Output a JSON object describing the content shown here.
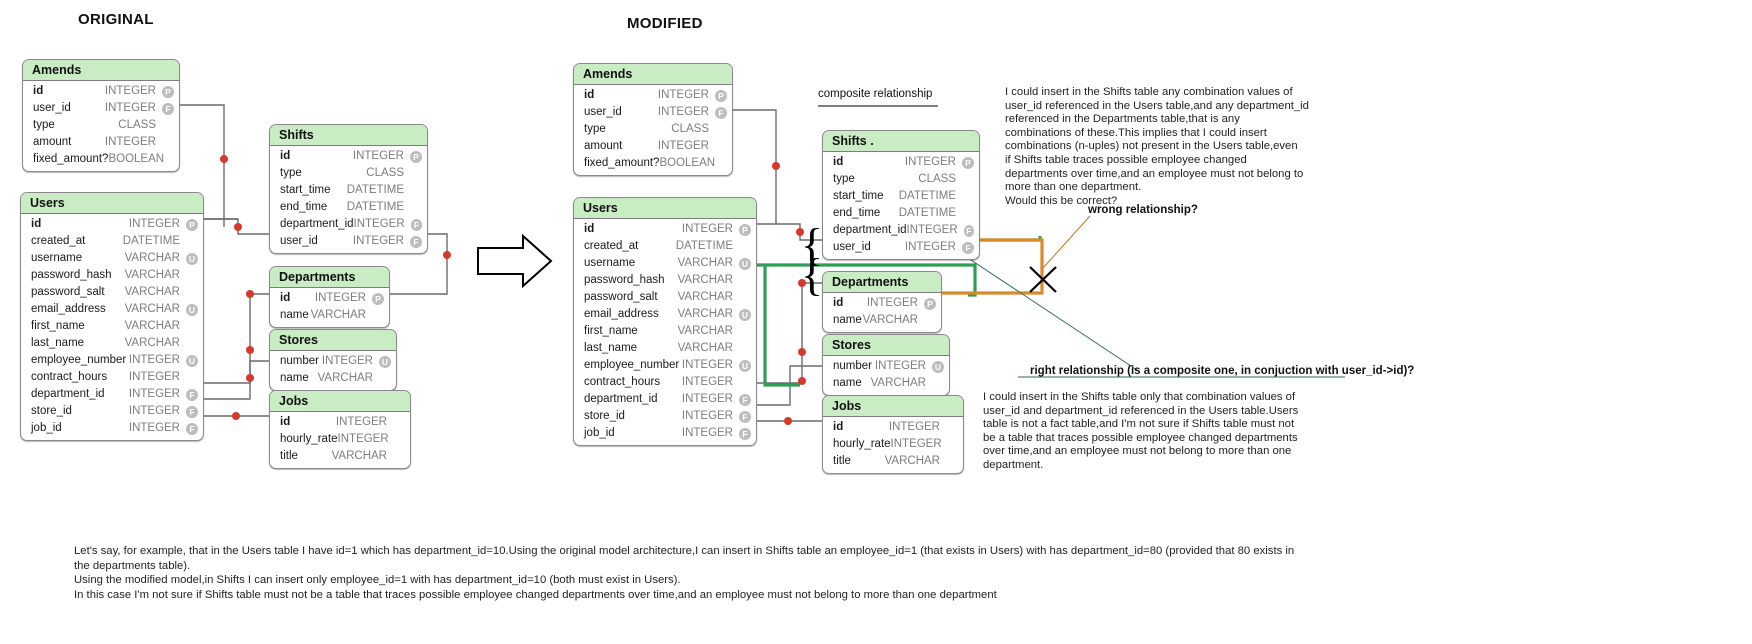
{
  "headings": {
    "original": "ORIGINAL",
    "modified": "MODIFIED"
  },
  "labels": {
    "composite_relationship": "composite relationship",
    "wrong_relationship": "wrong relationship?",
    "right_relationship": "right relationship (is a composite one, in conjuction with user_id->id)?"
  },
  "badges": {
    "primary": "P",
    "foreign": "F",
    "unique": "U"
  },
  "original": {
    "tables": [
      {
        "name": "Amends",
        "fields": [
          {
            "name": "id",
            "type": "INTEGER",
            "key": "P",
            "pk": true
          },
          {
            "name": "user_id",
            "type": "INTEGER",
            "key": "F",
            "pk": false
          },
          {
            "name": "type",
            "type": "CLASS",
            "key": "",
            "pk": false
          },
          {
            "name": "amount",
            "type": "INTEGER",
            "key": "",
            "pk": false
          },
          {
            "name": "fixed_amount?",
            "type": "BOOLEAN",
            "key": "",
            "pk": false
          }
        ]
      },
      {
        "name": "Users",
        "fields": [
          {
            "name": "id",
            "type": "INTEGER",
            "key": "P",
            "pk": true
          },
          {
            "name": "created_at",
            "type": "DATETIME",
            "key": "",
            "pk": false
          },
          {
            "name": "username",
            "type": "VARCHAR",
            "key": "U",
            "pk": false
          },
          {
            "name": "password_hash",
            "type": "VARCHAR",
            "key": "",
            "pk": false
          },
          {
            "name": "password_salt",
            "type": "VARCHAR",
            "key": "",
            "pk": false
          },
          {
            "name": "email_address",
            "type": "VARCHAR",
            "key": "U",
            "pk": false
          },
          {
            "name": "first_name",
            "type": "VARCHAR",
            "key": "",
            "pk": false
          },
          {
            "name": "last_name",
            "type": "VARCHAR",
            "key": "",
            "pk": false
          },
          {
            "name": "employee_number",
            "type": "INTEGER",
            "key": "U",
            "pk": false
          },
          {
            "name": "contract_hours",
            "type": "INTEGER",
            "key": "",
            "pk": false
          },
          {
            "name": "department_id",
            "type": "INTEGER",
            "key": "F",
            "pk": false
          },
          {
            "name": "store_id",
            "type": "INTEGER",
            "key": "F",
            "pk": false
          },
          {
            "name": "job_id",
            "type": "INTEGER",
            "key": "F",
            "pk": false
          }
        ]
      },
      {
        "name": "Shifts",
        "fields": [
          {
            "name": "id",
            "type": "INTEGER",
            "key": "P",
            "pk": true
          },
          {
            "name": "type",
            "type": "CLASS",
            "key": "",
            "pk": false
          },
          {
            "name": "start_time",
            "type": "DATETIME",
            "key": "",
            "pk": false
          },
          {
            "name": "end_time",
            "type": "DATETIME",
            "key": "",
            "pk": false
          },
          {
            "name": "department_id",
            "type": "INTEGER",
            "key": "F",
            "pk": false
          },
          {
            "name": "user_id",
            "type": "INTEGER",
            "key": "F",
            "pk": false
          }
        ]
      },
      {
        "name": "Departments",
        "fields": [
          {
            "name": "id",
            "type": "INTEGER",
            "key": "P",
            "pk": true
          },
          {
            "name": "name",
            "type": "VARCHAR",
            "key": "",
            "pk": false
          }
        ]
      },
      {
        "name": "Stores",
        "fields": [
          {
            "name": "number",
            "type": "INTEGER",
            "key": "U",
            "pk": false
          },
          {
            "name": "name",
            "type": "VARCHAR",
            "key": "",
            "pk": false
          }
        ]
      },
      {
        "name": "Jobs",
        "fields": [
          {
            "name": "id",
            "type": "INTEGER",
            "key": "P",
            "pk": true
          },
          {
            "name": "hourly_rate",
            "type": "INTEGER",
            "key": "",
            "pk": false
          },
          {
            "name": "title",
            "type": "VARCHAR",
            "key": "",
            "pk": false
          }
        ]
      }
    ]
  },
  "modified": {
    "tables": [
      {
        "name": "Amends",
        "fields": [
          {
            "name": "id",
            "type": "INTEGER",
            "key": "P",
            "pk": true
          },
          {
            "name": "user_id",
            "type": "INTEGER",
            "key": "F",
            "pk": false
          },
          {
            "name": "type",
            "type": "CLASS",
            "key": "",
            "pk": false
          },
          {
            "name": "amount",
            "type": "INTEGER",
            "key": "",
            "pk": false
          },
          {
            "name": "fixed_amount?",
            "type": "BOOLEAN",
            "key": "",
            "pk": false
          }
        ]
      },
      {
        "name": "Users",
        "fields": [
          {
            "name": "id",
            "type": "INTEGER",
            "key": "P",
            "pk": true
          },
          {
            "name": "created_at",
            "type": "DATETIME",
            "key": "",
            "pk": false
          },
          {
            "name": "username",
            "type": "VARCHAR",
            "key": "U",
            "pk": false
          },
          {
            "name": "password_hash",
            "type": "VARCHAR",
            "key": "",
            "pk": false
          },
          {
            "name": "password_salt",
            "type": "VARCHAR",
            "key": "",
            "pk": false
          },
          {
            "name": "email_address",
            "type": "VARCHAR",
            "key": "U",
            "pk": false
          },
          {
            "name": "first_name",
            "type": "VARCHAR",
            "key": "",
            "pk": false
          },
          {
            "name": "last_name",
            "type": "VARCHAR",
            "key": "",
            "pk": false
          },
          {
            "name": "employee_number",
            "type": "INTEGER",
            "key": "U",
            "pk": false
          },
          {
            "name": "contract_hours",
            "type": "INTEGER",
            "key": "",
            "pk": false
          },
          {
            "name": "department_id",
            "type": "INTEGER",
            "key": "F",
            "pk": false
          },
          {
            "name": "store_id",
            "type": "INTEGER",
            "key": "F",
            "pk": false
          },
          {
            "name": "job_id",
            "type": "INTEGER",
            "key": "F",
            "pk": false
          }
        ]
      },
      {
        "name": "Shifts .",
        "fields": [
          {
            "name": "id",
            "type": "INTEGER",
            "key": "P",
            "pk": true
          },
          {
            "name": "type",
            "type": "CLASS",
            "key": "",
            "pk": false
          },
          {
            "name": "start_time",
            "type": "DATETIME",
            "key": "",
            "pk": false
          },
          {
            "name": "end_time",
            "type": "DATETIME",
            "key": "",
            "pk": false
          },
          {
            "name": "department_id",
            "type": "INTEGER",
            "key": "F",
            "pk": false
          },
          {
            "name": "user_id",
            "type": "INTEGER",
            "key": "F",
            "pk": false
          }
        ]
      },
      {
        "name": "Departments",
        "fields": [
          {
            "name": "id",
            "type": "INTEGER",
            "key": "P",
            "pk": true
          },
          {
            "name": "name",
            "type": "VARCHAR",
            "key": "",
            "pk": false
          }
        ]
      },
      {
        "name": "Stores",
        "fields": [
          {
            "name": "number",
            "type": "INTEGER",
            "key": "U",
            "pk": false
          },
          {
            "name": "name",
            "type": "VARCHAR",
            "key": "",
            "pk": false
          }
        ]
      },
      {
        "name": "Jobs",
        "fields": [
          {
            "name": "id",
            "type": "INTEGER",
            "key": "P",
            "pk": true
          },
          {
            "name": "hourly_rate",
            "type": "INTEGER",
            "key": "",
            "pk": false
          },
          {
            "name": "title",
            "type": "VARCHAR",
            "key": "",
            "pk": false
          }
        ]
      }
    ]
  },
  "notes": {
    "top_right": "I could insert in the Shifts table any combination values of\nuser_id referenced in the Users table,and any department_id\nreferenced in the Departments table,that is any\ncombinations of these.This implies that I could insert\ncombinations (n-uples) not present in the Users table,even\nif Shifts table traces possible employee changed\ndepartments over time,and an employee must not belong to\nmore than one department.\nWould this be correct?",
    "bottom_right": "I could insert in the Shifts table only that combination values of\nuser_id and department_id referenced in the Users table.Users\ntable is not a fact table,and I'm not sure if Shifts table must not\nbe a table that traces possible employee changed departments\nover time,and an employee must not belong to more than one\ndepartment."
  },
  "footer": {
    "text": "Let's say, for example, that in the Users table I have id=1 which has department_id=10.Using the original model architecture,I can insert in Shifts table an employee_id=1 (that exists in Users) with has department_id=80 (provided that 80 exists in\nthe departments table).\nUsing the modified model,in Shifts I can insert only employee_id=1 with has department_id=10 (both must exist in Users).\nIn this case I'm not sure if Shifts table must not be a table that traces possible employee changed departments over time,and an employee must not belong to more than one department"
  },
  "colors": {
    "header_green": "#c9ecc4",
    "wire_gray": "#6b6b6b",
    "dot_red": "#d6382b",
    "highlight_green": "#2e9e54",
    "highlight_orange": "#d98b2b",
    "cross_black": "#000000"
  }
}
